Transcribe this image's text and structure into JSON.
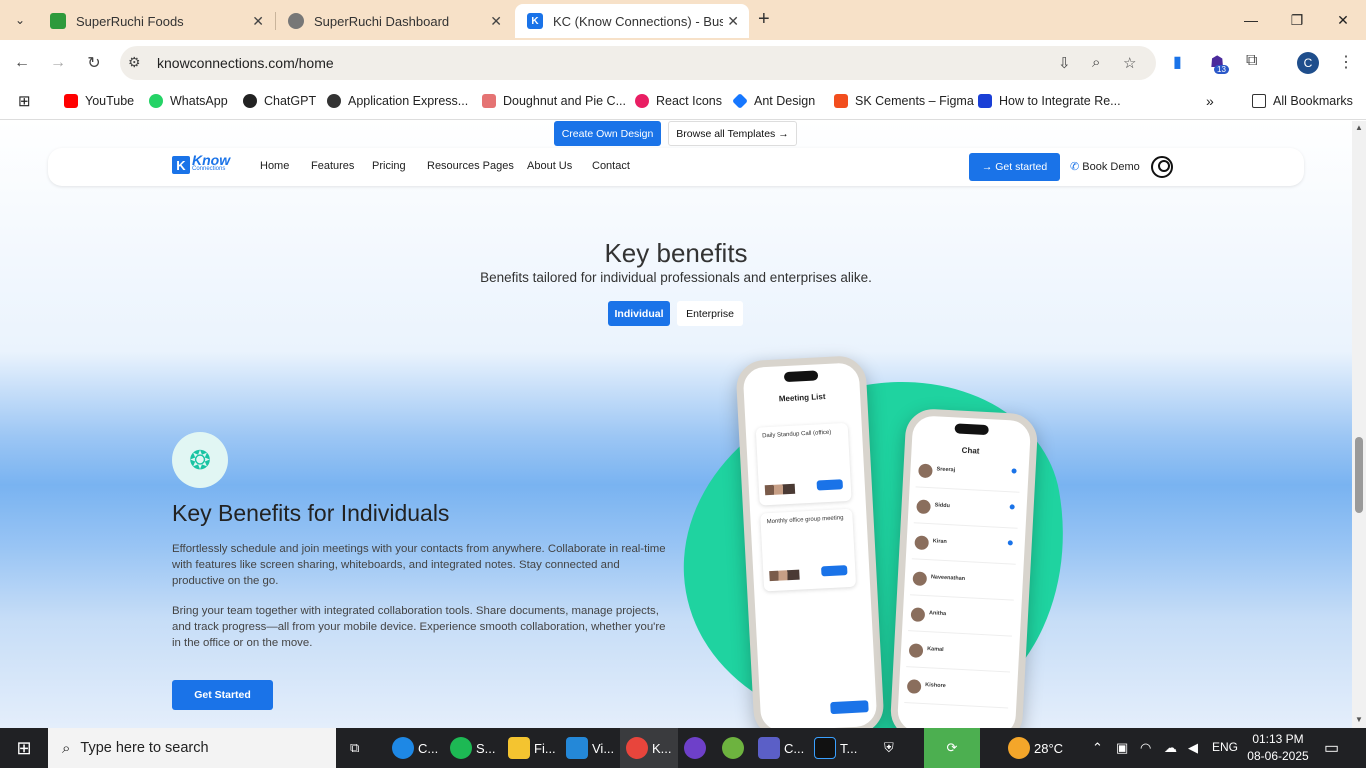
{
  "browser": {
    "tabs": [
      {
        "title": "SuperRuchi Foods",
        "icon": "superruchi-icon"
      },
      {
        "title": "SuperRuchi Dashboard",
        "icon": "globe-icon"
      },
      {
        "title": "KC (Know Connections) - Busine",
        "icon": "kc-icon",
        "active": true
      }
    ],
    "url": "knowconnections.com/home",
    "profile_initial": "C",
    "extension_badge": "13",
    "bookmarks": [
      {
        "label": "YouTube",
        "color": "#ff0000"
      },
      {
        "label": "WhatsApp",
        "color": "#25d366"
      },
      {
        "label": "ChatGPT",
        "color": "#222222"
      },
      {
        "label": "Application Express...",
        "color": "#333333"
      },
      {
        "label": "Doughnut and Pie C...",
        "color": "#e57373"
      },
      {
        "label": "React Icons",
        "color": "#e91e63"
      },
      {
        "label": "Ant Design",
        "color": "#1677ff"
      },
      {
        "label": "SK Cements – Figma",
        "color": "#f24e1e"
      },
      {
        "label": "How to Integrate Re...",
        "color": "#1a3fd6"
      }
    ],
    "all_bookmarks": "All Bookmarks"
  },
  "site": {
    "top_buttons": {
      "create": "Create Own Design",
      "browse": "Browse all Templates →"
    },
    "logo": {
      "line1": "Know",
      "line2": "Connections",
      "mark": "K"
    },
    "nav": [
      "Home",
      "Features",
      "Pricing",
      "Resources Pages",
      "About Us",
      "Contact"
    ],
    "get_started": "→ Get started",
    "book_demo": "Book Demo",
    "section_title": "Key benefits",
    "section_subtitle": "Benefits tailored for individual professionals and enterprises alike.",
    "toggle": {
      "individual": "Individual",
      "enterprise": "Enterprise"
    },
    "individual": {
      "title": "Key Benefits for Individuals",
      "para1": "Effortlessly schedule and join meetings with your contacts from anywhere. Collaborate in real-time with features like screen sharing, whiteboards, and integrated notes. Stay connected and productive on the go.",
      "para2": "Bring your team together with integrated collaboration tools. Share documents, manage projects, and track progress—all from your mobile device. Experience smooth collaboration, whether you're in the office or on the move.",
      "cta": "Get Started"
    },
    "phone_meeting": {
      "title": "Meeting List",
      "meetings": [
        "Daily Standup Call (office)",
        "Monthly office group meeting"
      ]
    },
    "phone_chat": {
      "title": "Chat",
      "contacts": [
        "Sreeraj",
        "Siddu",
        "Kiran",
        "Naveenathan",
        "Anitha",
        "Kamal",
        "Kishore"
      ]
    }
  },
  "taskbar": {
    "search_placeholder": "Type here to search",
    "apps": [
      "C...",
      "S...",
      "Fi...",
      "Vi...",
      "K...",
      "",
      "",
      "C...",
      "T..."
    ],
    "weather": "28°C",
    "language": "ENG",
    "time": "01:13 PM",
    "date": "08-06-2025"
  }
}
